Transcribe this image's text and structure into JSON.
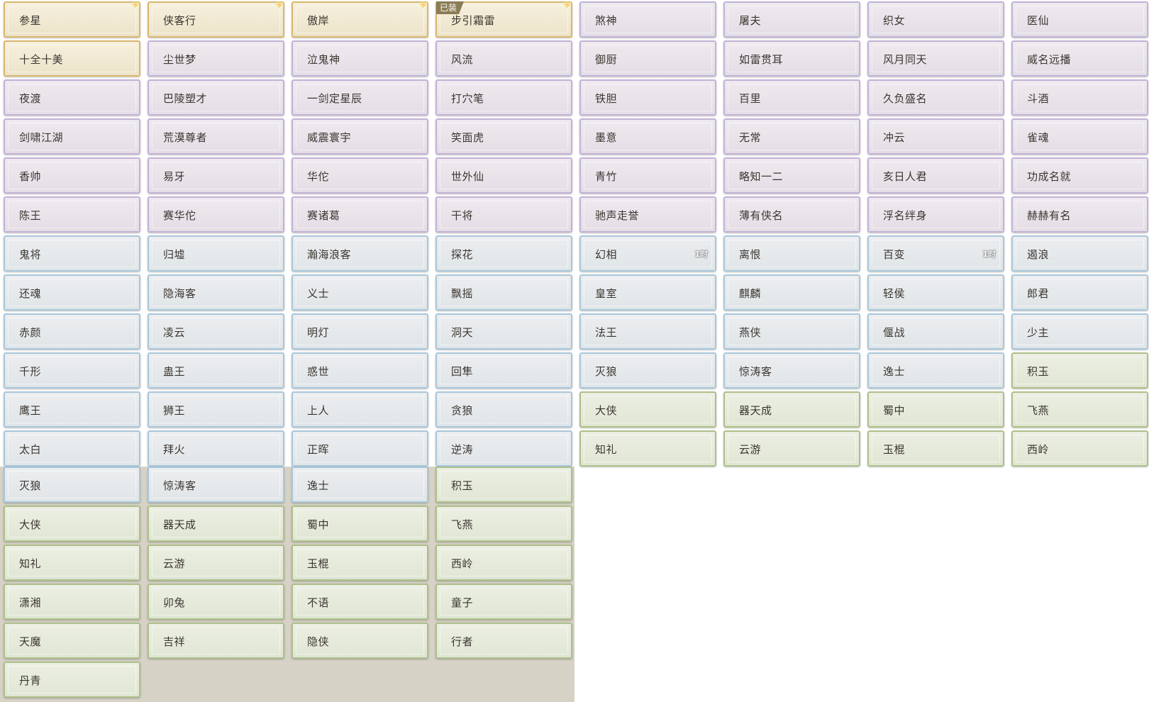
{
  "equipped_badge": "已装",
  "colors": {
    "gold": "#d9b76f",
    "purple": "#c2b3d6",
    "blue": "#a9c7da",
    "green": "#aec08b"
  },
  "titles_top": [
    {
      "name": "参星",
      "rarity": "gold",
      "sparkle": true
    },
    {
      "name": "侠客行",
      "rarity": "gold",
      "sparkle": true
    },
    {
      "name": "傲岸",
      "rarity": "gold",
      "sparkle": true
    },
    {
      "name": "步引霜雷",
      "rarity": "gold",
      "sparkle": true,
      "equipped": true
    },
    {
      "name": "煞神",
      "rarity": "purple"
    },
    {
      "name": "屠夫",
      "rarity": "purple"
    },
    {
      "name": "织女",
      "rarity": "purple"
    },
    {
      "name": "医仙",
      "rarity": "purple"
    },
    {
      "name": "十全十美",
      "rarity": "gold"
    },
    {
      "name": "尘世梦",
      "rarity": "purple"
    },
    {
      "name": "泣鬼神",
      "rarity": "purple"
    },
    {
      "name": "风流",
      "rarity": "purple"
    },
    {
      "name": "御厨",
      "rarity": "purple"
    },
    {
      "name": "如雷贯耳",
      "rarity": "purple"
    },
    {
      "name": "风月同天",
      "rarity": "purple"
    },
    {
      "name": "威名远播",
      "rarity": "purple"
    },
    {
      "name": "夜渡",
      "rarity": "purple"
    },
    {
      "name": "巴陵塑才",
      "rarity": "purple"
    },
    {
      "name": "一剑定星辰",
      "rarity": "purple"
    },
    {
      "name": "打穴笔",
      "rarity": "purple"
    },
    {
      "name": "铁胆",
      "rarity": "purple"
    },
    {
      "name": "百里",
      "rarity": "purple"
    },
    {
      "name": "久负盛名",
      "rarity": "purple"
    },
    {
      "name": "斗酒",
      "rarity": "purple"
    },
    {
      "name": "剑啸江湖",
      "rarity": "purple"
    },
    {
      "name": "荒漠尊者",
      "rarity": "purple"
    },
    {
      "name": "威震寰宇",
      "rarity": "purple"
    },
    {
      "name": "笑面虎",
      "rarity": "purple"
    },
    {
      "name": "墨意",
      "rarity": "purple"
    },
    {
      "name": "无常",
      "rarity": "purple"
    },
    {
      "name": "冲云",
      "rarity": "purple"
    },
    {
      "name": "雀魂",
      "rarity": "purple"
    },
    {
      "name": "香帅",
      "rarity": "purple"
    },
    {
      "name": "易牙",
      "rarity": "purple"
    },
    {
      "name": "华佗",
      "rarity": "purple"
    },
    {
      "name": "世外仙",
      "rarity": "purple"
    },
    {
      "name": "青竹",
      "rarity": "purple"
    },
    {
      "name": "略知一二",
      "rarity": "purple"
    },
    {
      "name": "亥日人君",
      "rarity": "purple"
    },
    {
      "name": "功成名就",
      "rarity": "purple"
    },
    {
      "name": "陈王",
      "rarity": "purple"
    },
    {
      "name": "赛华佗",
      "rarity": "purple"
    },
    {
      "name": "赛诸葛",
      "rarity": "purple"
    },
    {
      "name": "干将",
      "rarity": "purple"
    },
    {
      "name": "驰声走誉",
      "rarity": "purple"
    },
    {
      "name": "薄有侠名",
      "rarity": "purple"
    },
    {
      "name": "浮名绊身",
      "rarity": "purple"
    },
    {
      "name": "赫赫有名",
      "rarity": "purple"
    },
    {
      "name": "鬼将",
      "rarity": "blue"
    },
    {
      "name": "归墟",
      "rarity": "blue"
    },
    {
      "name": "瀚海浪客",
      "rarity": "blue"
    },
    {
      "name": "探花",
      "rarity": "blue"
    },
    {
      "name": "幻相",
      "rarity": "blue",
      "timer": "1时"
    },
    {
      "name": "离恨",
      "rarity": "blue"
    },
    {
      "name": "百变",
      "rarity": "blue",
      "timer": "1时"
    },
    {
      "name": "遏浪",
      "rarity": "blue"
    },
    {
      "name": "还魂",
      "rarity": "blue"
    },
    {
      "name": "隐海客",
      "rarity": "blue"
    },
    {
      "name": "义士",
      "rarity": "blue"
    },
    {
      "name": "飘摇",
      "rarity": "blue"
    },
    {
      "name": "皇室",
      "rarity": "blue"
    },
    {
      "name": "麒麟",
      "rarity": "blue"
    },
    {
      "name": "轻侯",
      "rarity": "blue"
    },
    {
      "name": "郎君",
      "rarity": "blue"
    },
    {
      "name": "赤颜",
      "rarity": "blue"
    },
    {
      "name": "凌云",
      "rarity": "blue"
    },
    {
      "name": "明灯",
      "rarity": "blue"
    },
    {
      "name": "洞天",
      "rarity": "blue"
    },
    {
      "name": "法王",
      "rarity": "blue"
    },
    {
      "name": "燕侠",
      "rarity": "blue"
    },
    {
      "name": "偃战",
      "rarity": "blue"
    },
    {
      "name": "少主",
      "rarity": "blue"
    },
    {
      "name": "千形",
      "rarity": "blue"
    },
    {
      "name": "蛊王",
      "rarity": "blue"
    },
    {
      "name": "惑世",
      "rarity": "blue"
    },
    {
      "name": "回隼",
      "rarity": "blue"
    },
    {
      "name": "灭狼",
      "rarity": "blue"
    },
    {
      "name": "惊涛客",
      "rarity": "blue"
    },
    {
      "name": "逸士",
      "rarity": "blue"
    },
    {
      "name": "积玉",
      "rarity": "green"
    },
    {
      "name": "鹰王",
      "rarity": "blue"
    },
    {
      "name": "狮王",
      "rarity": "blue"
    },
    {
      "name": "上人",
      "rarity": "blue"
    },
    {
      "name": "贪狼",
      "rarity": "blue"
    },
    {
      "name": "大侠",
      "rarity": "green"
    },
    {
      "name": "器天成",
      "rarity": "green"
    },
    {
      "name": "蜀中",
      "rarity": "green"
    },
    {
      "name": "飞燕",
      "rarity": "green"
    },
    {
      "name": "太白",
      "rarity": "blue"
    },
    {
      "name": "拜火",
      "rarity": "blue"
    },
    {
      "name": "正晖",
      "rarity": "blue"
    },
    {
      "name": "逆涛",
      "rarity": "blue"
    },
    {
      "name": "知礼",
      "rarity": "green"
    },
    {
      "name": "云游",
      "rarity": "green"
    },
    {
      "name": "玉棍",
      "rarity": "green"
    },
    {
      "name": "西岭",
      "rarity": "green"
    }
  ],
  "titles_bottom": [
    {
      "name": "灭狼",
      "rarity": "blue"
    },
    {
      "name": "惊涛客",
      "rarity": "blue"
    },
    {
      "name": "逸士",
      "rarity": "blue"
    },
    {
      "name": "积玉",
      "rarity": "green"
    },
    {
      "name": "大侠",
      "rarity": "green"
    },
    {
      "name": "器天成",
      "rarity": "green"
    },
    {
      "name": "蜀中",
      "rarity": "green"
    },
    {
      "name": "飞燕",
      "rarity": "green"
    },
    {
      "name": "知礼",
      "rarity": "green"
    },
    {
      "name": "云游",
      "rarity": "green"
    },
    {
      "name": "玉棍",
      "rarity": "green"
    },
    {
      "name": "西岭",
      "rarity": "green"
    },
    {
      "name": "潇湘",
      "rarity": "green"
    },
    {
      "name": "卯兔",
      "rarity": "green"
    },
    {
      "name": "不语",
      "rarity": "green"
    },
    {
      "name": "童子",
      "rarity": "green"
    },
    {
      "name": "天魔",
      "rarity": "green"
    },
    {
      "name": "吉祥",
      "rarity": "green"
    },
    {
      "name": "隐侠",
      "rarity": "green"
    },
    {
      "name": "行者",
      "rarity": "green"
    },
    {
      "name": "丹青",
      "rarity": "green"
    }
  ]
}
